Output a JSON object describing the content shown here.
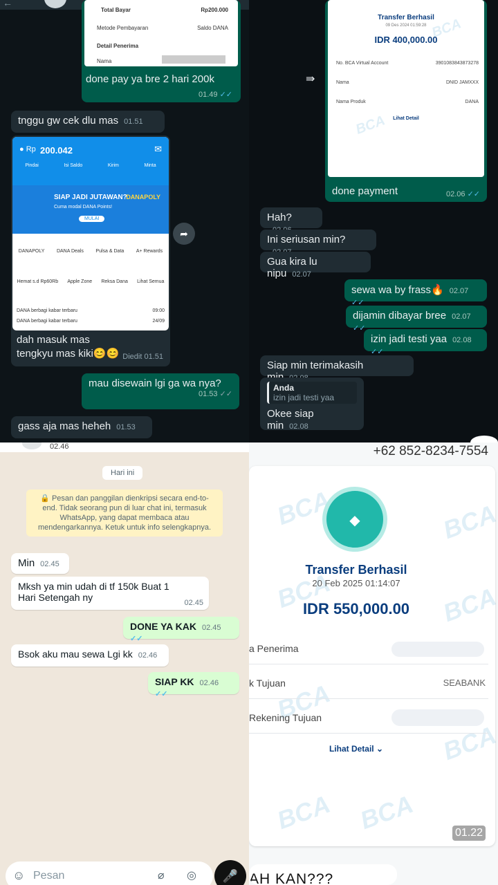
{
  "q1": {
    "top_card": {
      "total_label": "Total Bayar",
      "total_value": "Rp200.000",
      "method_label": "Metode Pembayaran",
      "method_value": "Saldo DANA",
      "detail_label": "Detail Penerima",
      "name_label": "Nama"
    },
    "msgs": [
      {
        "text": "done pay ya bre 2 hari 200k",
        "time": "01.49"
      },
      {
        "text": "tnggu gw cek dlu mas",
        "time": "01.51"
      },
      {
        "text": "dah masuk mas tengkyu mas kiki😊😊",
        "time": "Diedit 01.51"
      },
      {
        "text": "mau disewain lgi ga wa nya?",
        "time": "01.53"
      },
      {
        "text": "gass aja mas heheh",
        "time": "01.53"
      }
    ],
    "dana": {
      "balance": "200.042",
      "actions": [
        "Pindai",
        "Isi Saldo",
        "Kirim",
        "Minta"
      ],
      "promo_title": "SIAP JADI JUTAWAN?",
      "promo_sub": "Cuma modal DANA Points!",
      "promo_btn": "MULAI",
      "promo_brand": "DANAPOLY",
      "grid1": [
        "DANAPOLY",
        "DANA Deals",
        "Pulsa & Data",
        "A+ Rewards"
      ],
      "grid2": [
        "Hemat s.d Rp60Rb",
        "Apple Zone",
        "Reksa Dana",
        "Lihat Semua"
      ],
      "news": [
        {
          "text": "DANA berbagi kabar terbaru",
          "time": "09:00"
        },
        {
          "text": "DANA berbagi kabar terbaru",
          "time": "24/09"
        }
      ]
    }
  },
  "q2": {
    "receipt": {
      "title": "Transfer Berhasil",
      "date": "09 Des 2024 01:59:28",
      "amount": "IDR 400,000.00",
      "va_label": "No. BCA Virtual Account",
      "va_value": "3901083843873278",
      "name_label": "Nama",
      "name_value": "DNID JAMXXX",
      "prod_label": "Nama Produk",
      "prod_value": "DANA",
      "detail": "Lihat Detail"
    },
    "msgs": [
      {
        "text": "done payment",
        "time": "02.06"
      },
      {
        "text": "Hah?",
        "time": "02.06"
      },
      {
        "text": "Ini seriusan min?",
        "time": "02.07"
      },
      {
        "text": "Gua kira lu nipu",
        "time": "02.07"
      },
      {
        "text": "sewa wa by frass🔥",
        "time": "02.07"
      },
      {
        "text": "dijamin dibayar bree",
        "time": "02.07"
      },
      {
        "text": "izin jadi testi yaa",
        "time": "02.08"
      },
      {
        "text": "Siap min terimakasih min",
        "time": "02.08"
      },
      {
        "text": "Okee siap min",
        "time": "02.08"
      }
    ],
    "reply": {
      "author": "Anda",
      "quote": "izin jadi testi yaa"
    }
  },
  "q3": {
    "status_time": "02.46",
    "date_chip": "Hari ini",
    "encryption": "🔒 Pesan dan panggilan dienkripsi secara end-to-end. Tidak seorang pun di luar chat ini, termasuk WhatsApp, yang dapat membaca atau mendengarkannya. Ketuk untuk info selengkapnya.",
    "msgs": [
      {
        "text": "Min",
        "time": "02.45"
      },
      {
        "text": "Mksh ya min udah di tf 150k Buat 1 Hari Setengah ny",
        "time": "02.45"
      },
      {
        "text": "DONE YA KAK",
        "time": "02.45"
      },
      {
        "text": "Bsok aku mau sewa Lgi kk",
        "time": "02.46"
      },
      {
        "text": "SIAP KK",
        "time": "02.46"
      }
    ],
    "input_placeholder": "Pesan"
  },
  "q4": {
    "phone": "+62 852-8234-7554",
    "title": "Transfer Berhasil",
    "date": "20 Feb 2025 01:14:07",
    "amount": "IDR 550,000.00",
    "r1": "a Penerima",
    "r2": "k Tujuan",
    "r2_value": "SEABANK",
    "r3": "Rekening Tujuan",
    "detail": "Lihat Detail",
    "time": "01.22",
    "bottom_text": "AH KAN???",
    "watermark": "BCA"
  },
  "colors": {
    "wa_dark_out": "#005c4b",
    "wa_dark_in": "#202c33",
    "wa_light_out": "#d9fdd3",
    "dana_blue": "#118ee9",
    "bca_teal": "#21b8aa",
    "bca_blue": "#0a3d7e"
  }
}
